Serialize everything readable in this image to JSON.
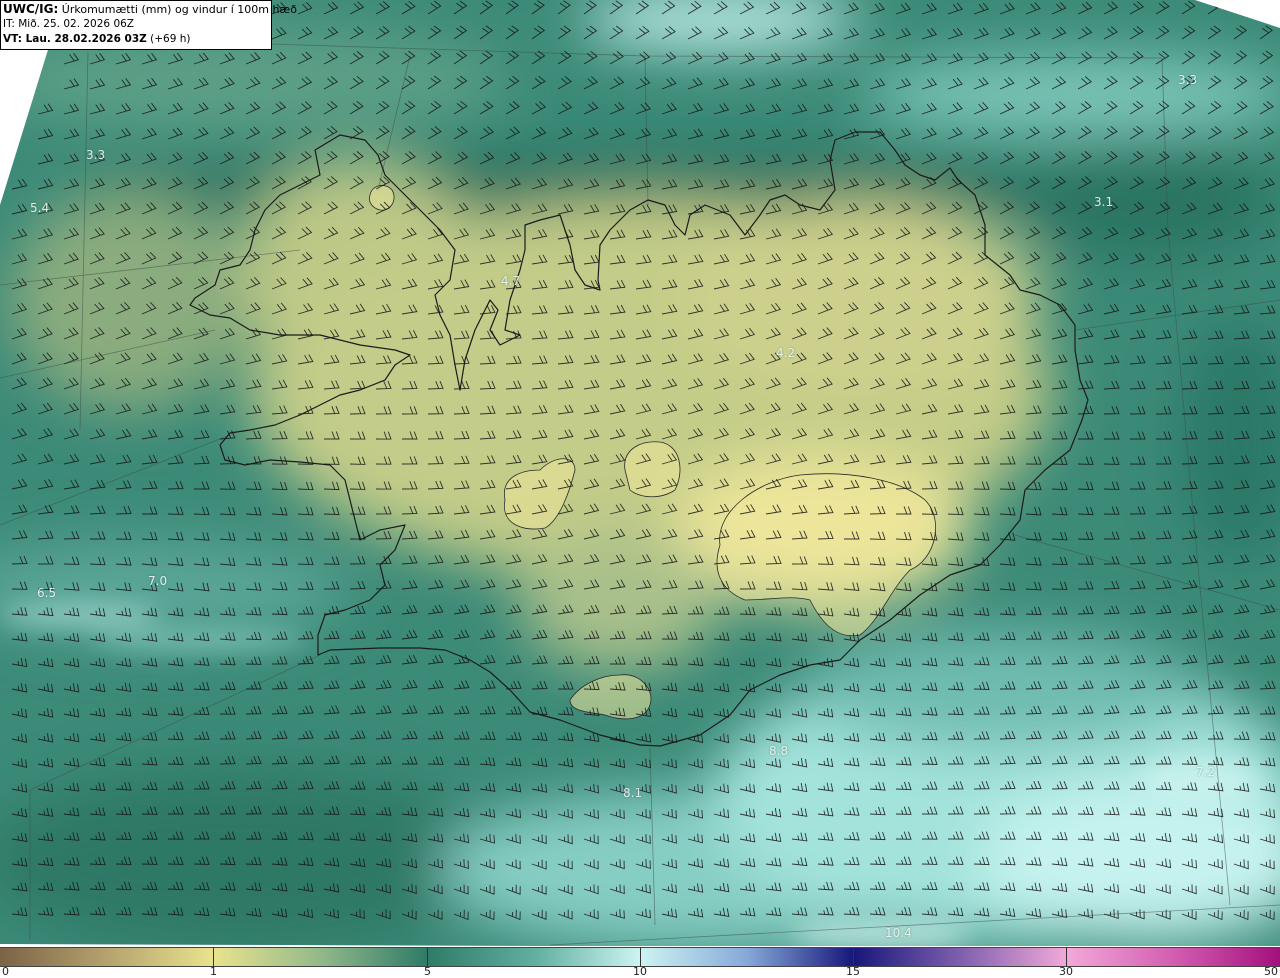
{
  "header": {
    "model": "UWC/IG:",
    "title": "Úrkomumætti (mm) og vindur í 100m hæð",
    "init_time": "IT: Mið. 25. 02. 2026 06Z",
    "valid_time": "VT: Lau. 28.02.2026 03Z",
    "lead_time": "(+69 h)"
  },
  "map": {
    "labels": [
      "3.3",
      "5.4",
      "4.7",
      "4.2",
      "3.1",
      "3.3",
      "6.5",
      "7.0",
      "8.8",
      "8.1",
      "7.2",
      "10.4"
    ]
  },
  "colorbar": {
    "ticks": [
      "0",
      "1",
      "5",
      "10",
      "15",
      "30",
      "50"
    ],
    "colors": [
      "#7b6345",
      "#b5a26e",
      "#e9e38d",
      "#93b98a",
      "#2f7b68",
      "#5fae9f",
      "#cdf4f1",
      "#86a9da",
      "#17177a",
      "#7e5fae",
      "#f2a9d9",
      "#d35eb1",
      "#a3107c"
    ]
  }
}
